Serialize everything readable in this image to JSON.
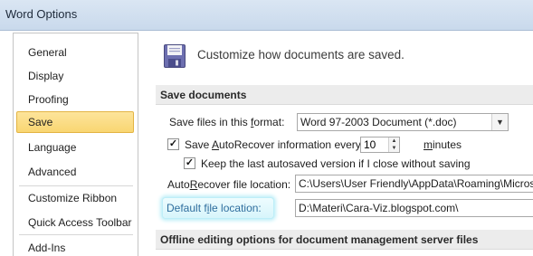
{
  "window": {
    "title": "Word Options"
  },
  "sidebar": {
    "items": [
      {
        "label": "General"
      },
      {
        "label": "Display"
      },
      {
        "label": "Proofing"
      },
      {
        "label": "Save"
      },
      {
        "label": "Language"
      },
      {
        "label": "Advanced"
      },
      {
        "label": "Customize Ribbon"
      },
      {
        "label": "Quick Access Toolbar"
      },
      {
        "label": "Add-Ins"
      }
    ],
    "selected": "Save"
  },
  "header": {
    "text": "Customize how documents are saved.",
    "icon": "floppy-disk-icon"
  },
  "save_documents": {
    "section_title": "Save documents",
    "format_label_pre": "Save files in this ",
    "format_label_ul": "f",
    "format_label_post": "ormat:",
    "format_value": "Word 97-2003 Document (*.doc)",
    "autorecover_pre": "Save ",
    "autorecover_ul": "A",
    "autorecover_post": "utoRecover information every",
    "autorecover_checked": true,
    "autorecover_minutes": "10",
    "minutes_ul": "m",
    "minutes_post": "inutes",
    "keep_last_label": "Keep the last autosaved version if I close without saving",
    "keep_last_checked": true,
    "autorecover_location_pre": "Auto",
    "autorecover_location_ul": "R",
    "autorecover_location_post": "ecover file location:",
    "autorecover_location_value": "C:\\Users\\User Friendly\\AppData\\Roaming\\Microsoft",
    "default_location_pre": "Default f",
    "default_location_ul": "i",
    "default_location_post": "le location:",
    "default_location_value": "D:\\Materi\\Cara-Viz.blogspot.com\\"
  },
  "offline": {
    "section_title": "Offline editing options for document management server files"
  },
  "colors": {
    "selected_bg": "#f9d672",
    "highlight_glow": "#bfeff8",
    "highlight_text": "#2f6e9e"
  }
}
